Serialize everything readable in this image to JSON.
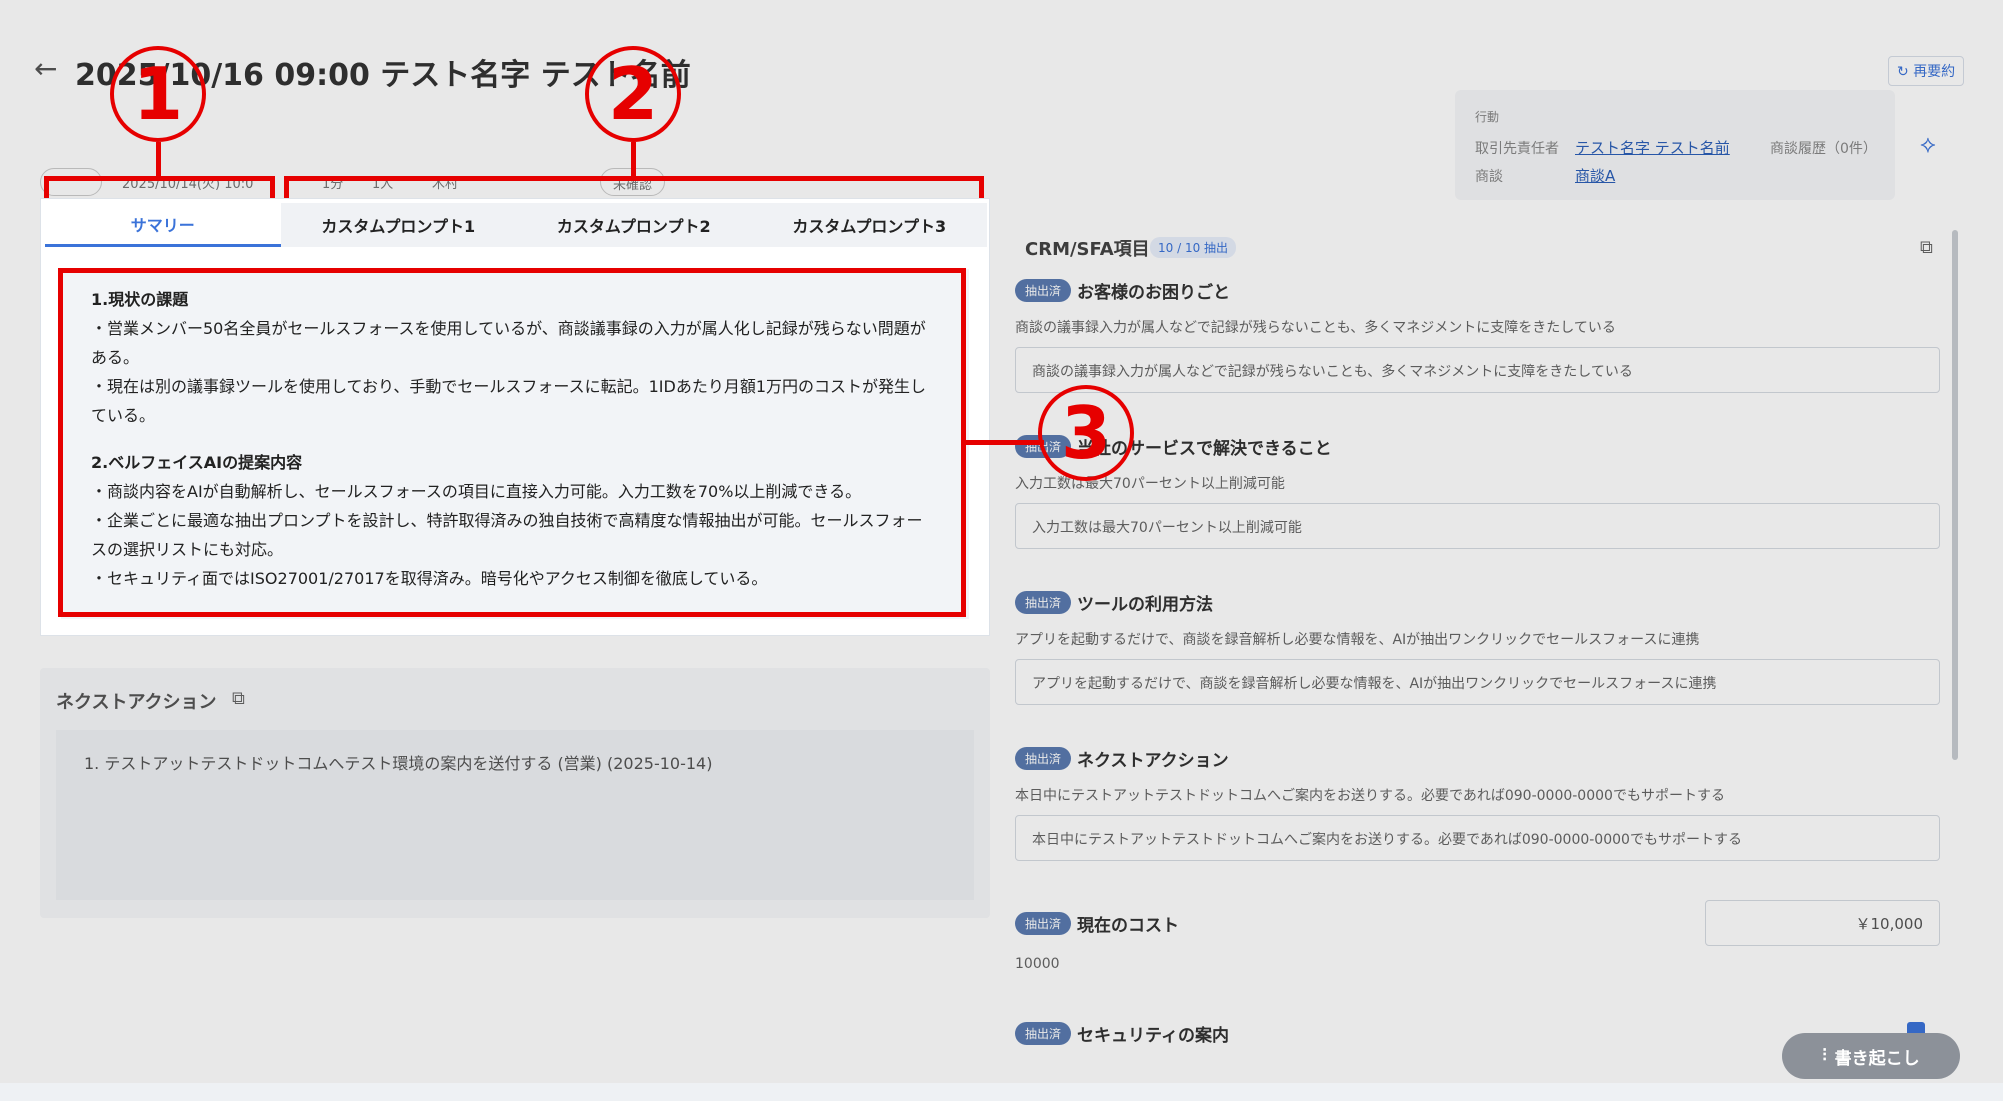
{
  "header": {
    "title": "2025/10/16 09:00 テスト名字 テスト名前",
    "back_icon": "arrow-left-icon",
    "resummarize": "再要約"
  },
  "info_card": {
    "section": "行動",
    "contact_label": "取引先責任者",
    "contact_value": "テスト名字 テスト名前",
    "deal_label": "商談",
    "deal_value": "商談A",
    "history_label": "商談履歴（0件）"
  },
  "meta_row": {
    "date_text": "2025/10/14(火) 10:0",
    "duration": "1分",
    "attendees": "1人",
    "owner": "木村",
    "status": "未確認"
  },
  "tabs": [
    "サマリー",
    "カスタムプロンプト1",
    "カスタムプロンプト2",
    "カスタムプロンプト3"
  ],
  "summary": {
    "section1_title": "1.現状の課題",
    "s1_line1": "・営業メンバー50名全員がセールスフォースを使用しているが、商談議事録の入力が属人化し記録が残らない問題が",
    "s1_line2": "ある。",
    "s1_line3": "・現在は別の議事録ツールを使用しており、手動でセールスフォースに転記。1IDあたり月額1万円のコストが発生し",
    "s1_line4": "ている。",
    "section2_title": "2.ベルフェイスAIの提案内容",
    "s2_line1": "・商談内容をAIが自動解析し、セールスフォースの項目に直接入力可能。入力工数を70%以上削減できる。",
    "s2_line2": "・企業ごとに最適な抽出プロンプトを設計し、特許取得済みの独自技術で高精度な情報抽出が可能。セールスフォー",
    "s2_line3": "スの選択リストにも対応。",
    "s2_line4": "・セキュリティ面ではISO27001/27017を取得済み。暗号化やアクセス制御を徹底している。"
  },
  "next_action": {
    "title": "ネクストアクション",
    "item": "1. テストアットテストドットコムへテスト環境の案内を送付する (営業) (2025-10-14)"
  },
  "crm": {
    "title": "CRM/SFA項目",
    "count": "10 / 10 抽出",
    "badge": "抽出済",
    "items": [
      {
        "title": "お客様のお困りごと",
        "desc": "商談の議事録入力が属人などで記録が残らないことも、多くマネジメントに支障をきたしている",
        "value": "商談の議事録入力が属人などで記録が残らないことも、多くマネジメントに支障をきたしている"
      },
      {
        "title": "当社のサービスで解決できること",
        "desc": "入力工数は最大70パーセント以上削減可能",
        "value": "入力工数は最大70パーセント以上削減可能"
      },
      {
        "title": "ツールの利用方法",
        "desc": "アプリを起動するだけで、商談を録音解析し必要な情報を、AIが抽出ワンクリックでセールスフォースに連携",
        "value": "アプリを起動するだけで、商談を録音解析し必要な情報を、AIが抽出ワンクリックでセールスフォースに連携"
      },
      {
        "title": "ネクストアクション",
        "desc": "本日中にテストアットテストドットコムへご案内をお送りする。必要であれば090-0000-0000でもサポートする",
        "value": "本日中にテストアットテストドットコムへご案内をお送りする。必要であれば090-0000-0000でもサポートする"
      },
      {
        "title": "現在のコスト",
        "desc": "10000",
        "value": "￥10,000"
      },
      {
        "title": "セキュリティの案内"
      }
    ]
  },
  "transcribe_button": "書き起こし",
  "annotations": [
    "1",
    "2",
    "3"
  ],
  "colors": {
    "accent": "#3b73d9",
    "annotation": "#e60000"
  }
}
